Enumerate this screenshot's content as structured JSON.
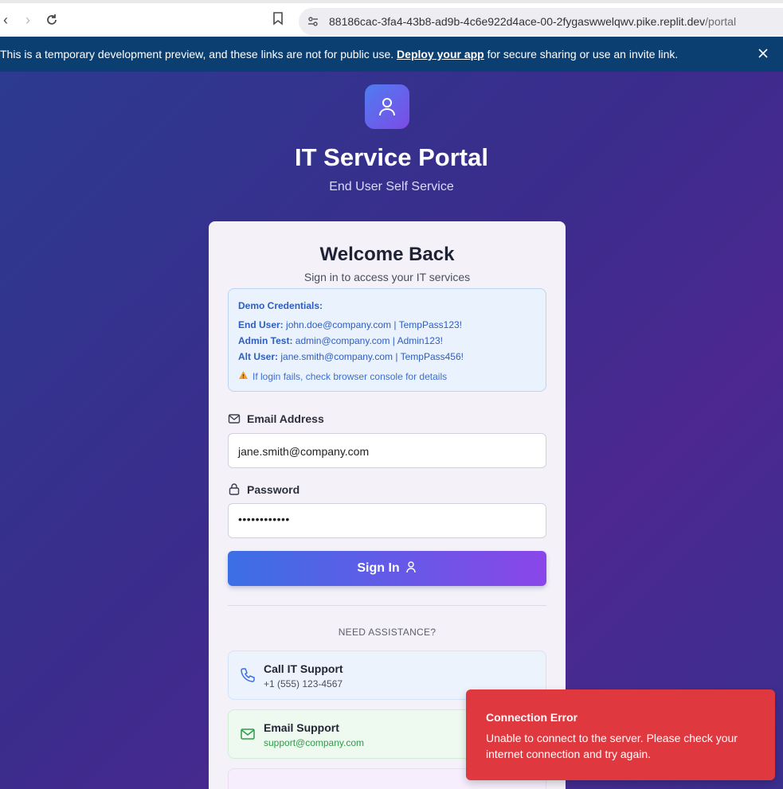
{
  "browser": {
    "url_host": "88186cac-3fa4-43b8-ad9b-4c6e922d4ace-00-2fygaswwelqwv.pike.replit.dev",
    "url_path": "/portal"
  },
  "dev_banner": {
    "text_before": "This is a temporary development preview, and these links are not for public use. ",
    "link": "Deploy your app",
    "text_after": " for secure sharing or use an invite link."
  },
  "portal": {
    "title": "IT Service Portal",
    "subtitle": "End User Self Service"
  },
  "card": {
    "title": "Welcome Back",
    "subtitle": "Sign in to access your IT services"
  },
  "demo": {
    "title": "Demo Credentials:",
    "lines": [
      {
        "label": "End User:",
        "value": " john.doe@company.com | TempPass123!"
      },
      {
        "label": "Admin Test:",
        "value": " admin@company.com | Admin123!"
      },
      {
        "label": "Alt User:",
        "value": " jane.smith@company.com | TempPass456!"
      }
    ],
    "warning": "If login fails, check browser console for details"
  },
  "form": {
    "email_label": "Email Address",
    "email_value": "jane.smith@company.com",
    "password_label": "Password",
    "password_mask": "••••••••••••",
    "signin_label": "Sign In"
  },
  "assist": {
    "label": "NEED ASSISTANCE?",
    "call_title": "Call IT Support",
    "call_sub": "+1 (555) 123-4567",
    "mail_title": "Email Support",
    "mail_sub": "support@company.com"
  },
  "toast": {
    "title": "Connection Error",
    "message": "Unable to connect to the server. Please check your internet connection and try again."
  },
  "colors": {
    "banner": "#0c3f71",
    "accent_start": "#3b6fe6",
    "accent_end": "#8a46e8",
    "error": "#e0383f"
  }
}
